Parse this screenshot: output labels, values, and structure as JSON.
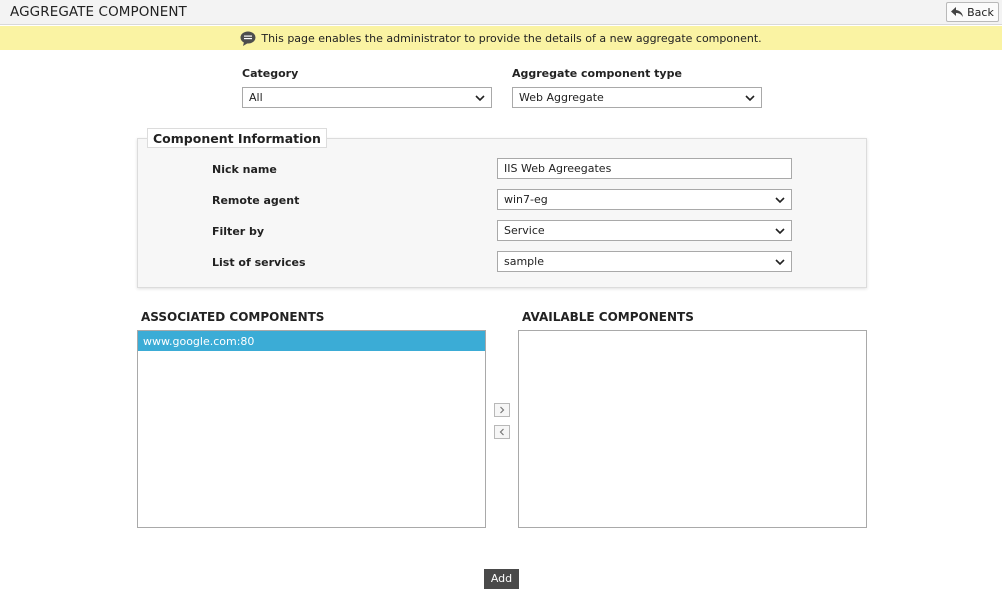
{
  "header": {
    "title": "AGGREGATE COMPONENT",
    "back_label": "Back"
  },
  "info": {
    "message": "This page enables the administrator to provide the details of a new aggregate component."
  },
  "top_form": {
    "category_label": "Category",
    "category_value": "All",
    "type_label": "Aggregate component type",
    "type_value": "Web Aggregate"
  },
  "component_info": {
    "legend": "Component Information",
    "nick_name_label": "Nick name",
    "nick_name_value": "IIS Web Agreegates",
    "remote_agent_label": "Remote agent",
    "remote_agent_value": "win7-eg",
    "filter_by_label": "Filter by",
    "filter_by_value": "Service",
    "services_label": "List of services",
    "services_value": "sample"
  },
  "associated": {
    "heading": "ASSOCIATED COMPONENTS",
    "items": [
      "www.google.com:80"
    ]
  },
  "available": {
    "heading": "AVAILABLE COMPONENTS",
    "items": []
  },
  "footer": {
    "add_label": "Add"
  },
  "colors": {
    "info_bg": "#faf3a3",
    "selected_item": "#3bacd6",
    "add_button": "#4a4a4a"
  }
}
